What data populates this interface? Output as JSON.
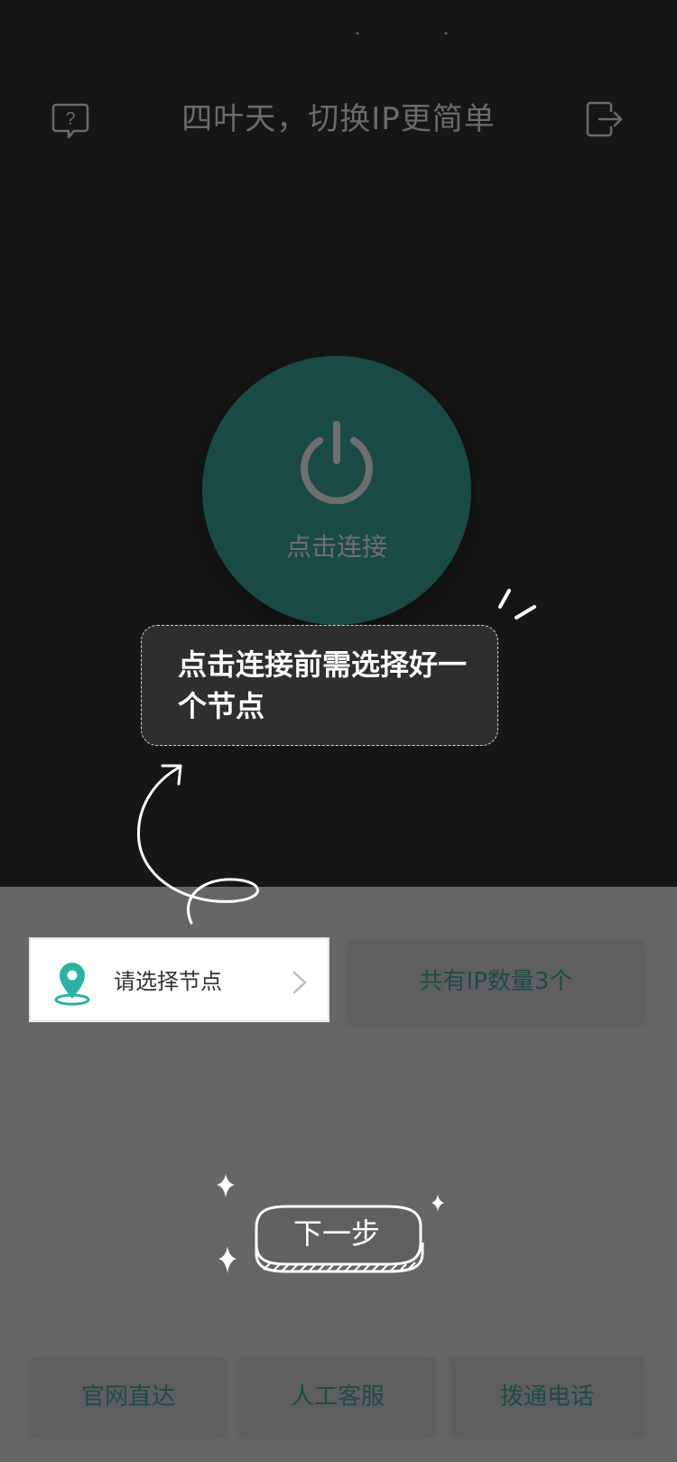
{
  "header": {
    "title": "四叶天，切换IP更简单",
    "help_icon": "help-chat-icon",
    "exit_icon": "logout-icon"
  },
  "power": {
    "label": "点击连接",
    "icon": "power-icon"
  },
  "guide": {
    "tip": "点击连接前需选择好一个节点",
    "next_label": "下一步"
  },
  "node_select": {
    "label": "请选择节点",
    "icon": "location-pin-icon"
  },
  "ip_count": {
    "label": "共有IP数量3个"
  },
  "actions": [
    {
      "label": "官网直达"
    },
    {
      "label": "人工客服"
    },
    {
      "label": "拨通电话"
    }
  ],
  "colors": {
    "overlay_dark": "#161616",
    "overlay_light": "#666666",
    "accent_teal": "#2ab3a2",
    "power_circle": "#1a4a45",
    "action_text": "#1f4a46"
  }
}
